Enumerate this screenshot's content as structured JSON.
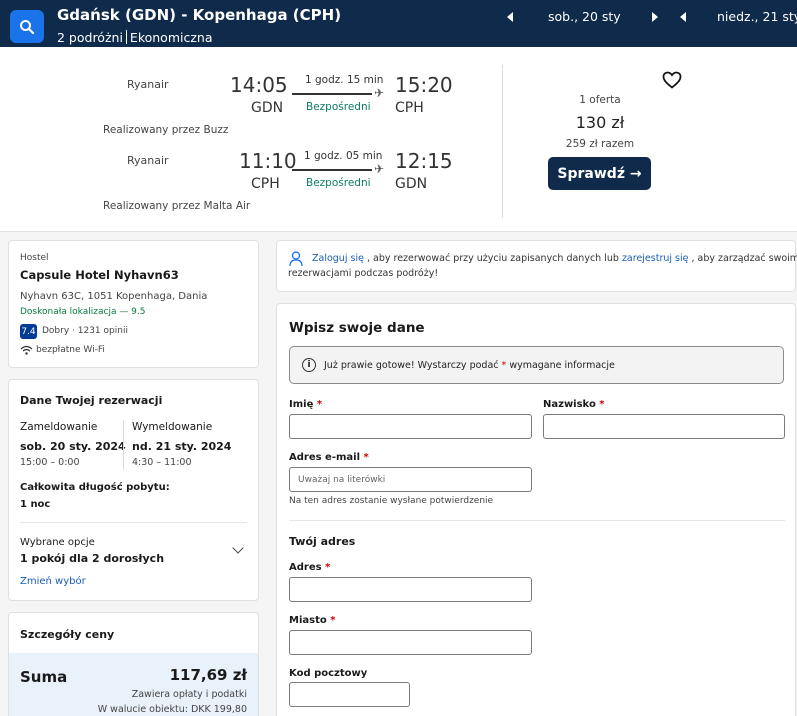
{
  "header": {
    "route": "Gdańsk (GDN) - Kopenhaga (CPH)",
    "travelers": "2 podróżni",
    "cabin": "Ekonomiczna",
    "date_out": "sob., 20 sty",
    "date_back": "niedz., 21 sty"
  },
  "flights": [
    {
      "airline": "Ryanair",
      "dep_time": "14:05",
      "dep_code": "GDN",
      "duration": "1 godz. 15 min",
      "stops": "Bezpośredni",
      "arr_time": "15:20",
      "arr_code": "CPH",
      "operated_by": "Realizowany przez Buzz"
    },
    {
      "airline": "Ryanair",
      "dep_time": "11:10",
      "dep_code": "CPH",
      "duration": "1 godz. 05 min",
      "stops": "Bezpośredni",
      "arr_time": "12:15",
      "arr_code": "GDN",
      "operated_by": "Realizowany przez Malta Air"
    }
  ],
  "offer": {
    "count": "1 oferta",
    "price": "130 zł",
    "total": "259 zł razem",
    "button": "Sprawdź →"
  },
  "hotel": {
    "type": "Hostel",
    "name": "Capsule Hotel Nyhavn63",
    "address": "Nyhavn 63C, 1051 Kopenhaga, Dania",
    "location_note": "Doskonała lokalizacja — 9.5",
    "score": "7.4",
    "score_text": "Dobry · 1231 opinii",
    "wifi": "bezpłatne Wi-Fi"
  },
  "booking": {
    "title": "Dane Twojej rezerwacji",
    "checkin_label": "Zameldowanie",
    "checkin_date": "sob. 20 sty. 2024",
    "checkin_time": "15:00 – 0:00",
    "checkout_label": "Wymeldowanie",
    "checkout_date": "nd. 21 sty. 2024",
    "checkout_time": "4:30 – 11:00",
    "stay_label": "Całkowita długość pobytu:",
    "stay_value": "1 noc",
    "options_label": "Wybrane opcje",
    "options_value": "1 pokój dla 2 dorosłych",
    "change_link": "Zmień wybór"
  },
  "price": {
    "title": "Szczegóły ceny",
    "sum_label": "Suma",
    "sum_value": "117,69 zł",
    "fees_note": "Zawiera opłaty i podatki",
    "local_currency": "W walucie obiektu: DKK 199,80"
  },
  "login_banner": {
    "link1": "Zaloguj się",
    "text1": ", aby rezerwować przy użyciu zapisanych danych lub",
    "link2": "zarejestruj się",
    "text2": ", aby zarządzać swoimi",
    "text3": "rezerwacjami podczas podróży!"
  },
  "form": {
    "title": "Wpisz swoje dane",
    "notice_pre": "Już prawie gotowe! Wystarczy podać",
    "notice_star": "*",
    "notice_post": "wymagane informacje",
    "first_name_label": "Imię",
    "last_name_label": "Nazwisko",
    "email_label": "Adres e-mail",
    "email_placeholder": "Uważaj na literówki",
    "email_hint": "Na ten adres zostanie wysłane potwierdzenie",
    "address_section": "Twój adres",
    "address_label": "Adres",
    "city_label": "Miasto",
    "postal_label": "Kod pocztowy",
    "req_mark": "*"
  },
  "colors": {
    "header_bg": "#0f2a4a",
    "accent": "#1a73e8",
    "link": "#1a5fb4",
    "direct": "#0a7c64"
  }
}
